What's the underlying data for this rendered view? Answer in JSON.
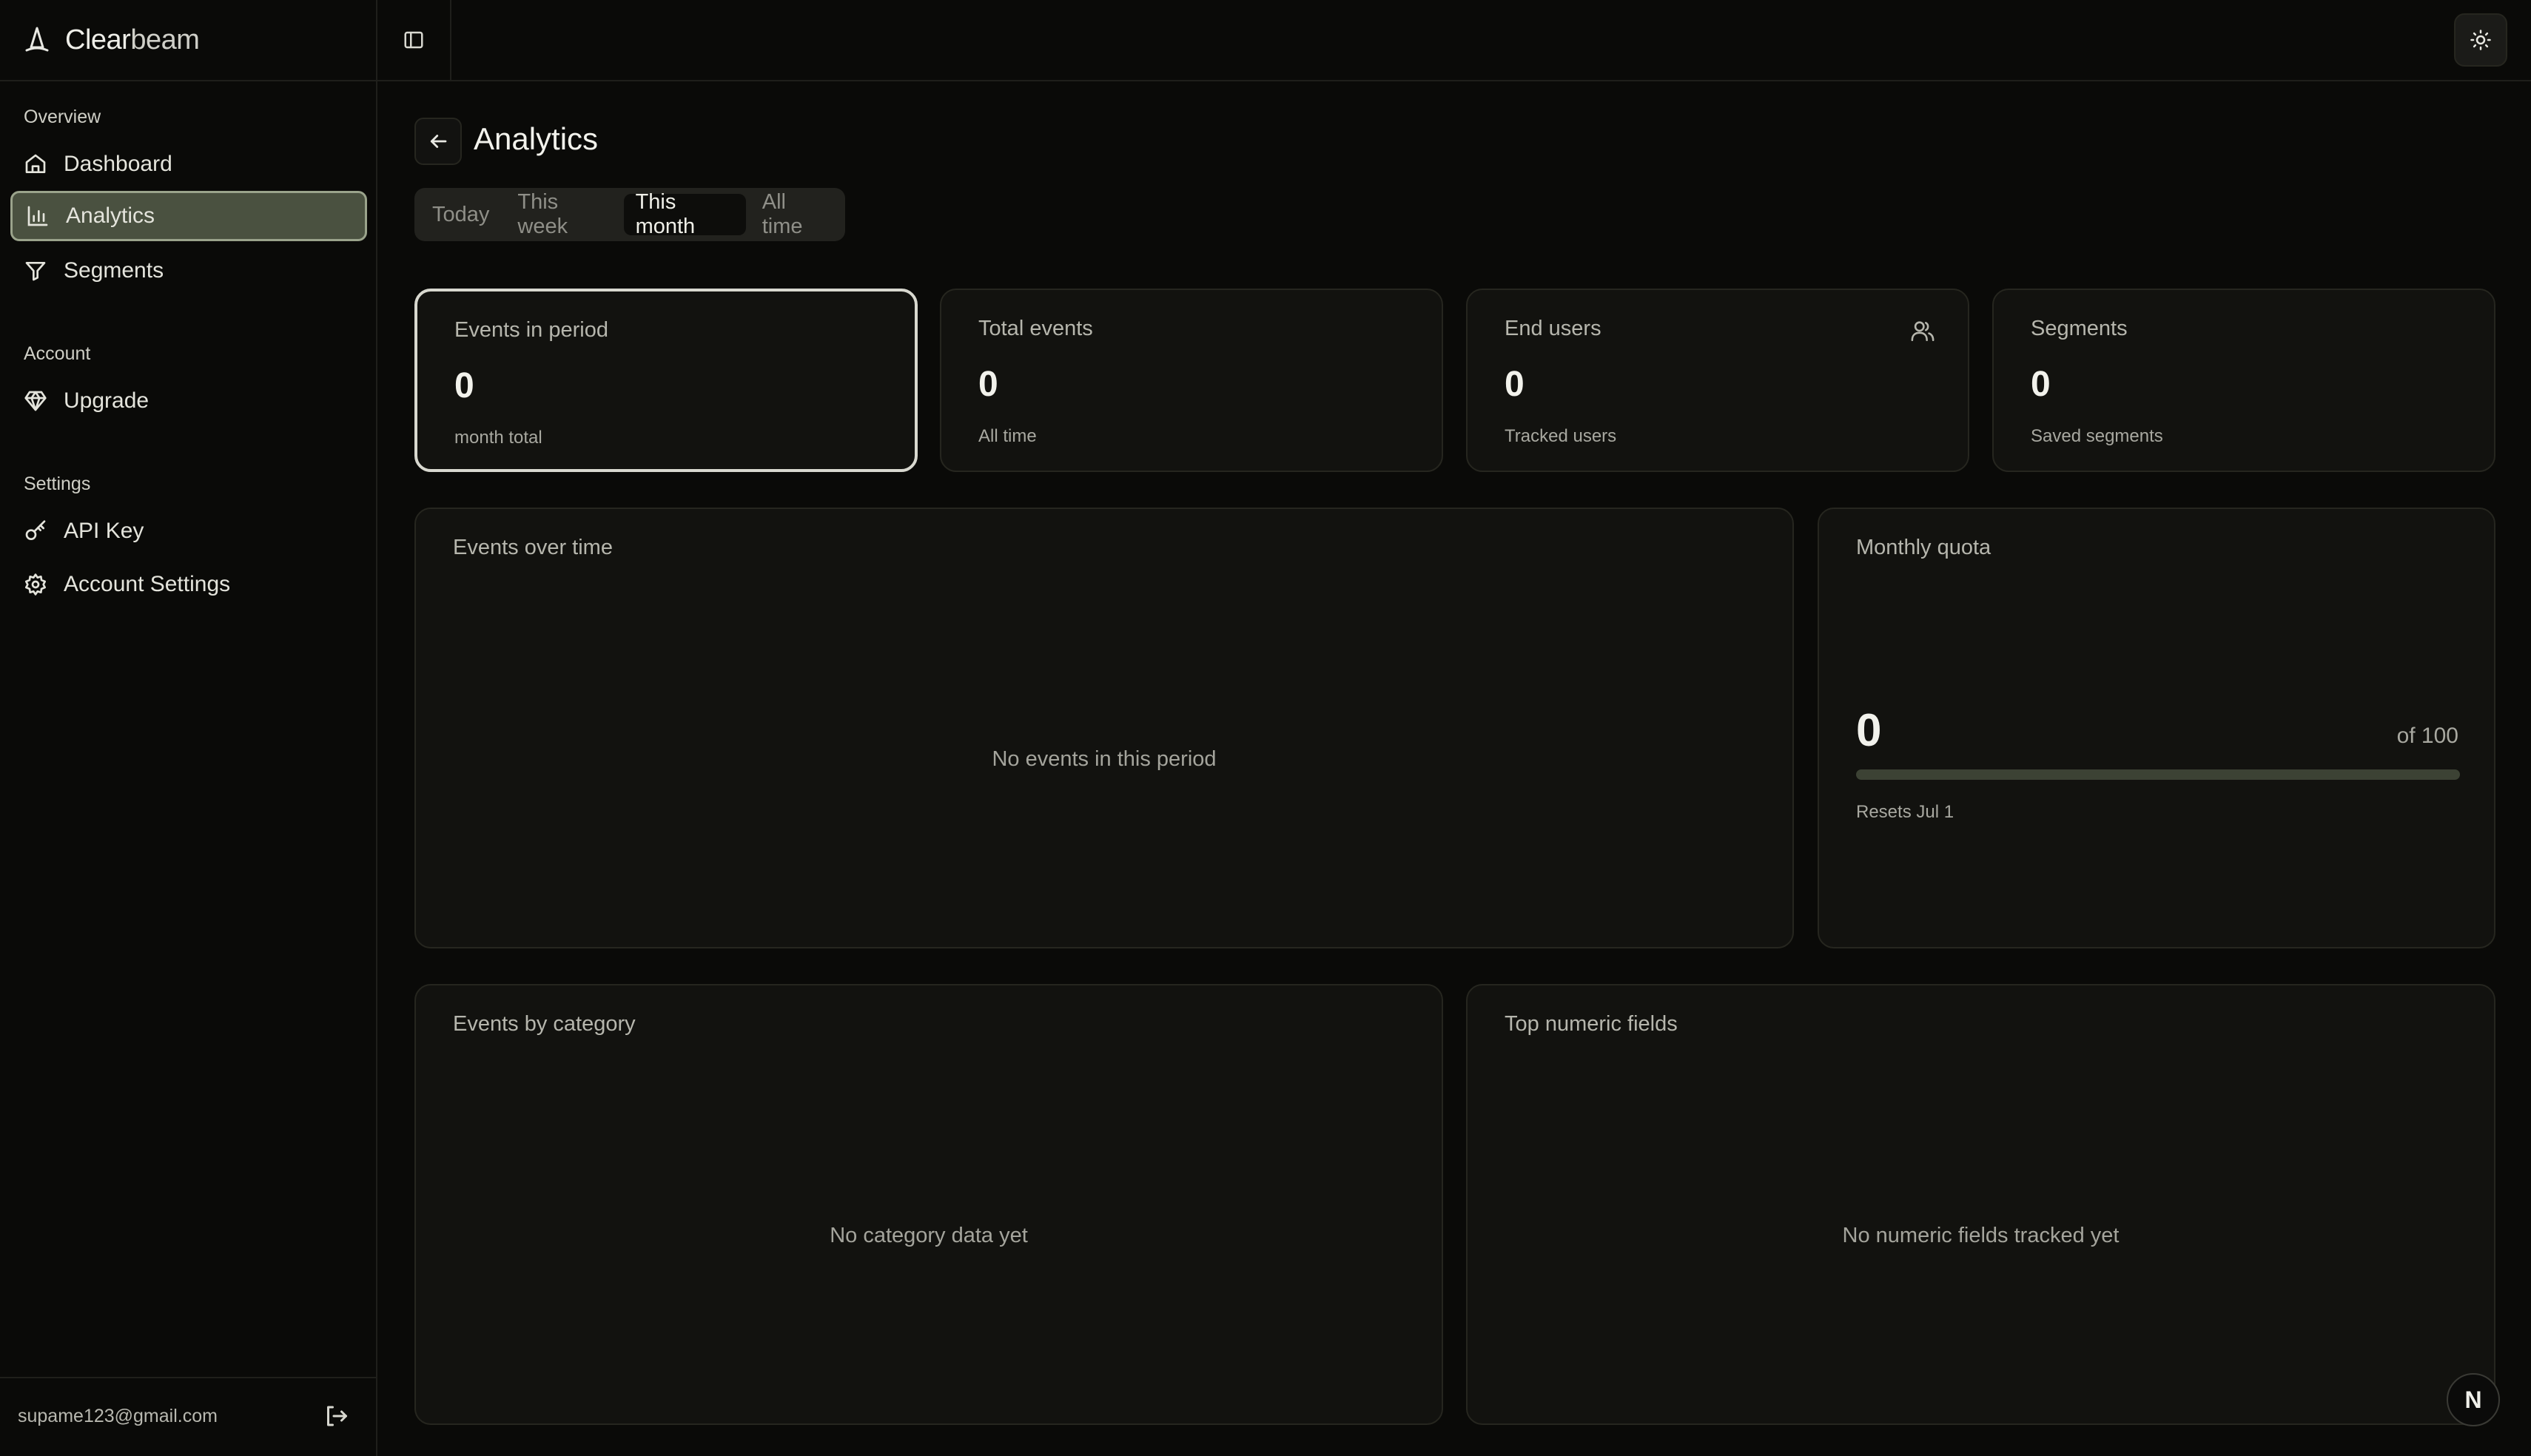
{
  "app": {
    "name_prefix": "Clear",
    "name_suffix": "beam"
  },
  "sidebar": {
    "sections": [
      {
        "label": "Overview",
        "items": [
          {
            "label": "Dashboard",
            "icon": "home-icon"
          },
          {
            "label": "Analytics",
            "icon": "bar-chart-icon",
            "active": true
          },
          {
            "label": "Segments",
            "icon": "filter-icon"
          }
        ]
      },
      {
        "label": "Account",
        "items": [
          {
            "label": "Upgrade",
            "icon": "gem-icon"
          }
        ]
      },
      {
        "label": "Settings",
        "items": [
          {
            "label": "API Key",
            "icon": "key-icon"
          },
          {
            "label": "Account Settings",
            "icon": "gear-icon"
          }
        ]
      }
    ],
    "user_email": "supame123@gmail.com"
  },
  "page": {
    "title": "Analytics",
    "tabs": [
      {
        "label": "Today"
      },
      {
        "label": "This week"
      },
      {
        "label": "This month",
        "active": true
      },
      {
        "label": "All time"
      }
    ]
  },
  "stats": [
    {
      "title": "Events in period",
      "value": "0",
      "sub": "month total",
      "selected": true
    },
    {
      "title": "Total events",
      "value": "0",
      "sub": "All time"
    },
    {
      "title": "End users",
      "value": "0",
      "sub": "Tracked users",
      "icon": "users-icon"
    },
    {
      "title": "Segments",
      "value": "0",
      "sub": "Saved segments"
    }
  ],
  "events_over_time": {
    "title": "Events over time",
    "empty": "No events in this period"
  },
  "monthly_quota": {
    "title": "Monthly quota",
    "value": "0",
    "limit_label": "of 100",
    "used_fraction": 0,
    "reset": "Resets Jul 1"
  },
  "events_by_category": {
    "title": "Events by category",
    "empty": "No category data yet"
  },
  "top_numeric_fields": {
    "title": "Top numeric fields",
    "empty": "No numeric fields tracked yet"
  },
  "badge": {
    "letter": "N"
  },
  "colors": {
    "accent": "#9aa38b",
    "active_bg": "#4a5140",
    "card_bg": "#12120f",
    "page_bg": "#0a0a08"
  }
}
